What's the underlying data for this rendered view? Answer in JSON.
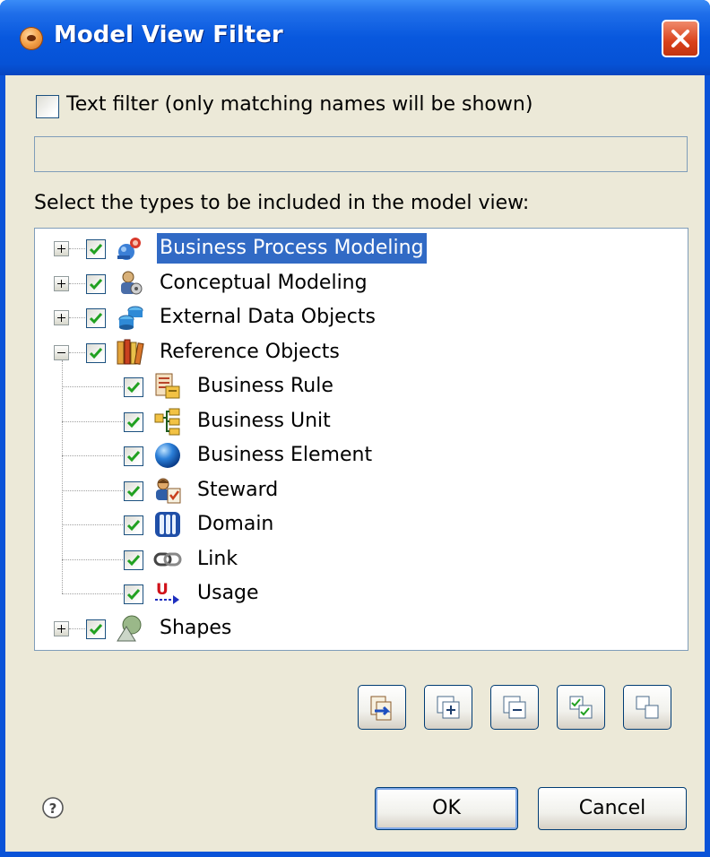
{
  "window": {
    "title": "Model View Filter"
  },
  "text_filter": {
    "checkbox_label": "Text filter (only matching names will be shown)",
    "checked": false,
    "input_value": "",
    "input_placeholder": ""
  },
  "types_label": "Select the types to be included in the model view:",
  "tree": [
    {
      "label": "Business Process Modeling",
      "icon": "business-process-modeling-icon",
      "expanded": false,
      "checked": true,
      "selected": true
    },
    {
      "label": "Conceptual Modeling",
      "icon": "conceptual-modeling-icon",
      "expanded": false,
      "checked": true
    },
    {
      "label": "External Data Objects",
      "icon": "external-data-objects-icon",
      "expanded": false,
      "checked": true
    },
    {
      "label": "Reference Objects",
      "icon": "reference-objects-icon",
      "expanded": true,
      "checked": true,
      "children": [
        {
          "label": "Business Rule",
          "icon": "business-rule-icon",
          "checked": true
        },
        {
          "label": "Business Unit",
          "icon": "business-unit-icon",
          "checked": true
        },
        {
          "label": "Business Element",
          "icon": "business-element-icon",
          "checked": true
        },
        {
          "label": "Steward",
          "icon": "steward-icon",
          "checked": true
        },
        {
          "label": "Domain",
          "icon": "domain-icon",
          "checked": true
        },
        {
          "label": "Link",
          "icon": "link-icon",
          "checked": true
        },
        {
          "label": "Usage",
          "icon": "usage-icon",
          "checked": true
        }
      ]
    },
    {
      "label": "Shapes",
      "icon": "shapes-icon",
      "expanded": false,
      "checked": true
    }
  ],
  "toolbar": [
    {
      "name": "sync-selection-button",
      "icon": "sync-icon"
    },
    {
      "name": "expand-all-button",
      "icon": "expand-all-icon"
    },
    {
      "name": "collapse-all-button",
      "icon": "collapse-all-icon"
    },
    {
      "name": "select-all-button",
      "icon": "select-all-icon"
    },
    {
      "name": "deselect-all-button",
      "icon": "deselect-all-icon"
    }
  ],
  "buttons": {
    "ok_label": "OK",
    "cancel_label": "Cancel"
  },
  "colors": {
    "titlebar": "#0858de",
    "selection": "#316ac5",
    "dialog_background": "#ece9d8",
    "checkmark": "#21a121"
  }
}
